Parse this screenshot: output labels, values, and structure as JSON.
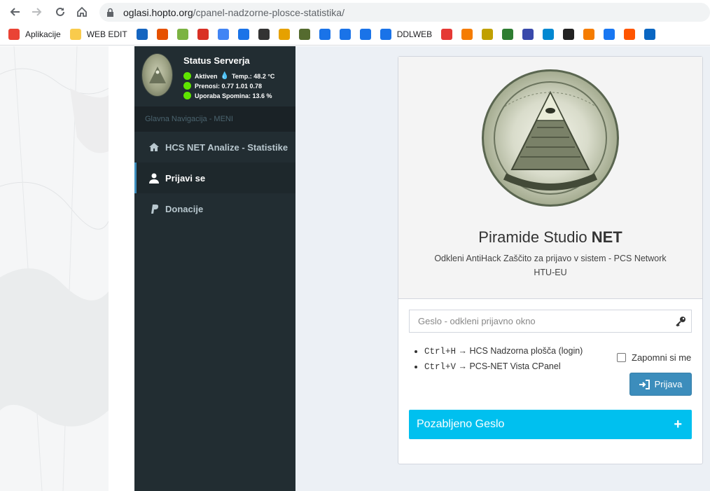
{
  "browser": {
    "url_host": "oglasi.hopto.org",
    "url_path": "/cpanel-nadzorne-plosce-statistika/"
  },
  "bookmarks": [
    {
      "label": "Aplikacije",
      "icon": "apps-grid-icon",
      "color": "#ea4335"
    },
    {
      "label": "WEB EDIT",
      "icon": "folder-icon",
      "color": "#f9cb4c"
    },
    {
      "label": "",
      "icon": "radio-signal-icon",
      "color": "#1565c0"
    },
    {
      "label": "",
      "icon": "t-logo-icon",
      "color": "#e65100"
    },
    {
      "label": "",
      "icon": "refresh-green-icon",
      "color": "#7cb342"
    },
    {
      "label": "",
      "icon": "gmail-icon",
      "color": "#d93025"
    },
    {
      "label": "",
      "icon": "translate-icon",
      "color": "#4285f4"
    },
    {
      "label": "",
      "icon": "calendar-icon",
      "color": "#1a73e8"
    },
    {
      "label": "",
      "icon": "speedometer-icon",
      "color": "#333333"
    },
    {
      "label": "",
      "icon": "pyramid-warning-icon",
      "color": "#e6a100"
    },
    {
      "label": "",
      "icon": "seal-icon",
      "color": "#556b2f"
    },
    {
      "label": "",
      "icon": "gear-icon",
      "color": "#1a73e8"
    },
    {
      "label": "",
      "icon": "star-icon",
      "color": "#1a73e8"
    },
    {
      "label": "",
      "icon": "puzzle-icon",
      "color": "#1a73e8"
    },
    {
      "label": "DDLWEB",
      "icon": "download-icon",
      "color": "#1a73e8"
    },
    {
      "label": "",
      "icon": "rainbow-icon",
      "color": "#e53935"
    },
    {
      "label": "",
      "icon": "b-circle-icon",
      "color": "#f57c00"
    },
    {
      "label": "",
      "icon": "pyramid-icon",
      "color": "#c0a000"
    },
    {
      "label": "",
      "icon": "lock-icon",
      "color": "#2e7d32"
    },
    {
      "label": "",
      "icon": "infinity-icon",
      "color": "#3949ab"
    },
    {
      "label": "",
      "icon": "cube-icon",
      "color": "#0288d1"
    },
    {
      "label": "",
      "icon": "wordpress-icon",
      "color": "#222222"
    },
    {
      "label": "",
      "icon": "blogger-icon",
      "color": "#f57c00"
    },
    {
      "label": "",
      "icon": "facebook-icon",
      "color": "#1877f2"
    },
    {
      "label": "",
      "icon": "soundcloud-icon",
      "color": "#ff5500"
    },
    {
      "label": "",
      "icon": "linkedin-icon",
      "color": "#0a66c2"
    }
  ],
  "sidebar": {
    "status_title": "Status Serverja",
    "status": {
      "active_label": "Aktiven",
      "temp": "Temp.: 48.2 °C",
      "transfers": "Prenosi: 0.77  1.01  0.78",
      "memory": "Uporaba Spomina: 13.6 %"
    },
    "nav_header": "Glavna Navigacija - MENI",
    "items": [
      {
        "label": "HCS NET Analize - Statistike",
        "icon": "home-icon",
        "active": false
      },
      {
        "label": "Prijavi se",
        "icon": "user-icon",
        "active": true
      },
      {
        "label": "Donacije",
        "icon": "paypal-icon",
        "active": false
      }
    ]
  },
  "login": {
    "brand_light": "Piramide Studio ",
    "brand_bold": "NET",
    "subtitle": "Odkleni AntiHack Zaščito za prijavo v sistem - PCS Network HTU-EU",
    "password_placeholder": "Geslo - odkleni prijavno okno",
    "shortcuts": [
      {
        "keys": "Ctrl+H",
        "text": " → HCS Nadzorna plošča (login)"
      },
      {
        "keys": "Ctrl+V",
        "text": " → PCS-NET Vista CPanel"
      }
    ],
    "remember_label": "Zapomni si me",
    "remember_checked": false,
    "login_button": "Prijava",
    "forgot_label": "Pozabljeno Geslo",
    "forgot_icon": "+"
  },
  "colors": {
    "sidebar_bg": "#222d32",
    "primary": "#3c8dbc",
    "info": "#00c0ef",
    "status_green": "#5fe400"
  }
}
